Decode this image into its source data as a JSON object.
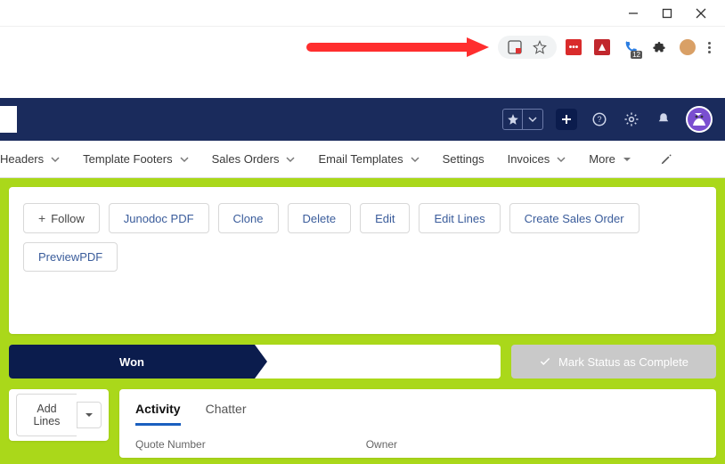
{
  "browser": {
    "badge_count": "12"
  },
  "nav": {
    "items": [
      {
        "label": "Headers"
      },
      {
        "label": "Template Footers"
      },
      {
        "label": "Sales Orders"
      },
      {
        "label": "Email Templates"
      },
      {
        "label": "Settings"
      },
      {
        "label": "Invoices"
      },
      {
        "label": "More"
      }
    ]
  },
  "actions": {
    "follow": "Follow",
    "buttons": [
      "Junodoc PDF",
      "Clone",
      "Delete",
      "Edit",
      "Edit Lines",
      "Create Sales Order",
      "PreviewPDF"
    ]
  },
  "status": {
    "current": "Won",
    "mark_complete": "Mark Status as Complete"
  },
  "left_panel": {
    "add_lines": "Add Lines"
  },
  "detail": {
    "tabs": {
      "activity": "Activity",
      "chatter": "Chatter"
    },
    "fields": {
      "quote_number": "Quote Number",
      "owner": "Owner"
    }
  }
}
